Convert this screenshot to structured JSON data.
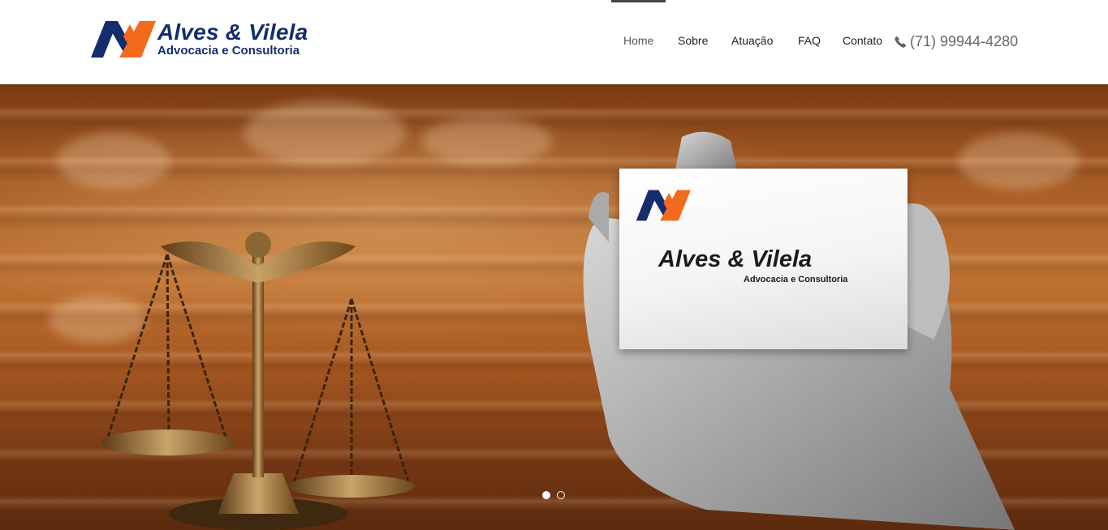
{
  "brand": {
    "name": "Alves & Vilela",
    "tagline": "Advocacia e Consultoria",
    "colors": {
      "navy": "#152d6d",
      "orange": "#f26a1b"
    }
  },
  "nav": {
    "items": [
      {
        "label": "Home",
        "active": true
      },
      {
        "label": "Sobre"
      },
      {
        "label": "Atuação"
      },
      {
        "label": "FAQ"
      },
      {
        "label": "Contato"
      }
    ],
    "phone": {
      "icon": "phone-icon",
      "number": "(71) 99944-4280"
    }
  },
  "hero": {
    "card": {
      "name": "Alves & Vilela",
      "tagline": "Advocacia e Consultoria"
    },
    "slider": {
      "active_slide": 1,
      "total_slides": 2
    }
  }
}
